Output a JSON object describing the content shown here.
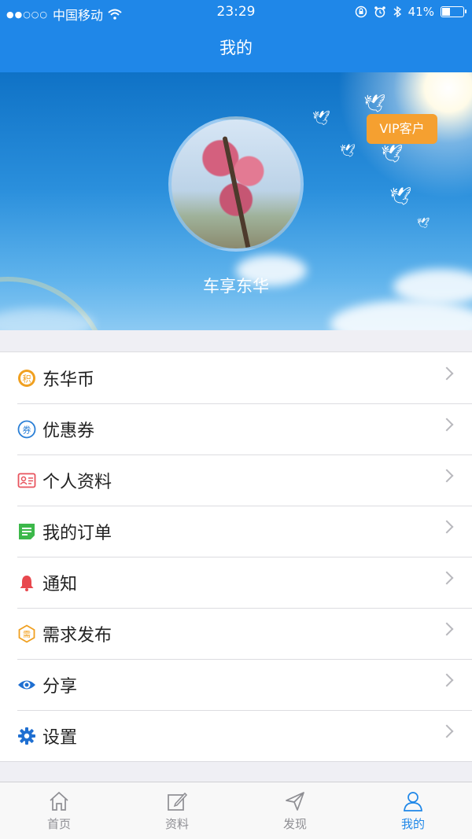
{
  "status": {
    "carrier": "中国移动",
    "time": "23:29",
    "battery": "41%",
    "battery_level": 0.41,
    "signal_dots": "●●○○○"
  },
  "nav": {
    "title": "我的"
  },
  "profile": {
    "username": "车享东华",
    "vip_label": "VIP客户"
  },
  "menu": {
    "items": [
      {
        "label": "东华币",
        "icon": "points-icon",
        "color": "#f0a020"
      },
      {
        "label": "优惠券",
        "icon": "coupon-icon",
        "color": "#2a7fd6"
      },
      {
        "label": "个人资料",
        "icon": "profile-card-icon",
        "color": "#e8545e"
      },
      {
        "label": "我的订单",
        "icon": "order-icon",
        "color": "#3cb84a"
      },
      {
        "label": "通知",
        "icon": "bell-icon",
        "color": "#e8484e"
      },
      {
        "label": "需求发布",
        "icon": "demand-icon",
        "color": "#f0a020"
      },
      {
        "label": "分享",
        "icon": "eye-icon",
        "color": "#1f6fd1"
      },
      {
        "label": "设置",
        "icon": "gear-icon",
        "color": "#1f6fd1"
      }
    ]
  },
  "tabbar": {
    "items": [
      {
        "label": "首页",
        "icon": "home-icon",
        "active": false
      },
      {
        "label": "资料",
        "icon": "edit-icon",
        "active": false
      },
      {
        "label": "发现",
        "icon": "send-icon",
        "active": false
      },
      {
        "label": "我的",
        "icon": "user-icon",
        "active": true
      }
    ]
  },
  "colors": {
    "accent": "#1f87e8",
    "vip": "#f5a030"
  }
}
